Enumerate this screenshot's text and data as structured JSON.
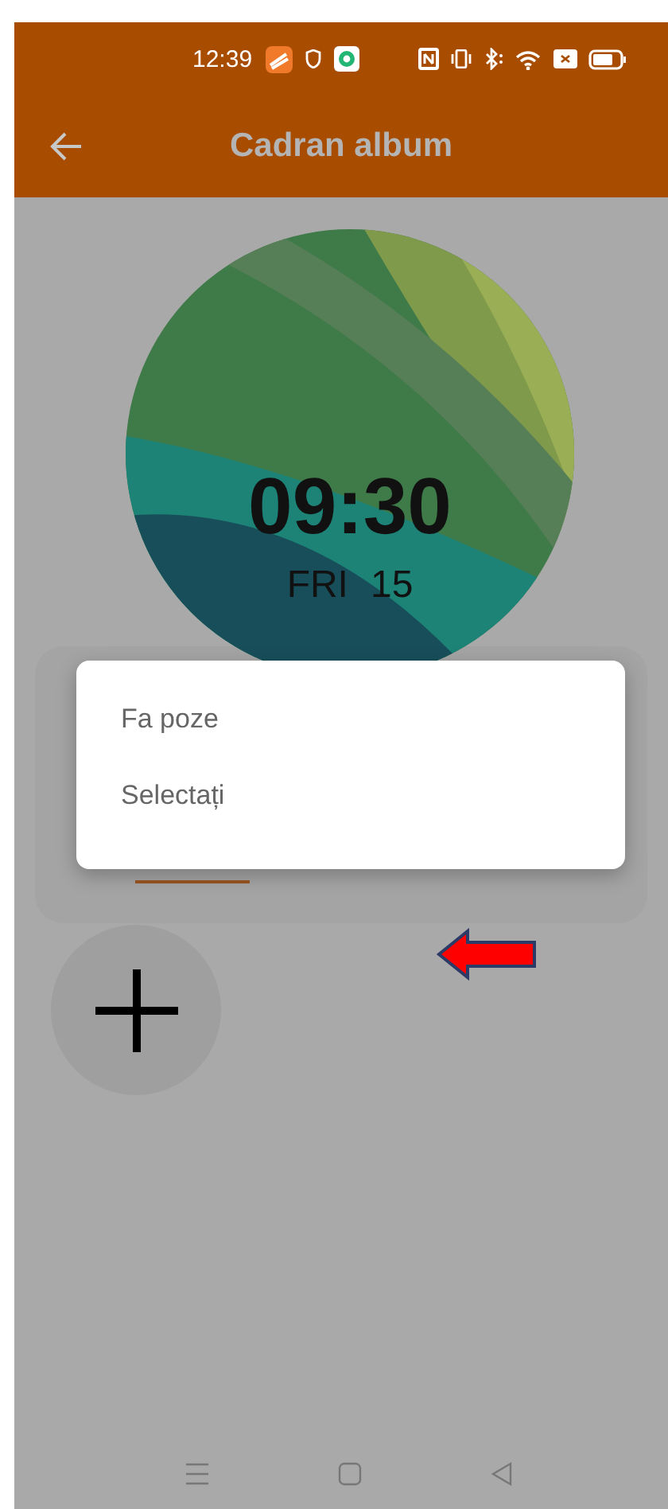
{
  "status_bar": {
    "time": "12:39"
  },
  "app_bar": {
    "title": "Cadran album"
  },
  "watch_face": {
    "time": "09:30",
    "day": "FRI",
    "date": "15"
  },
  "menu": {
    "items": [
      {
        "label": "Fa poze"
      },
      {
        "label": "Selectați"
      }
    ]
  }
}
